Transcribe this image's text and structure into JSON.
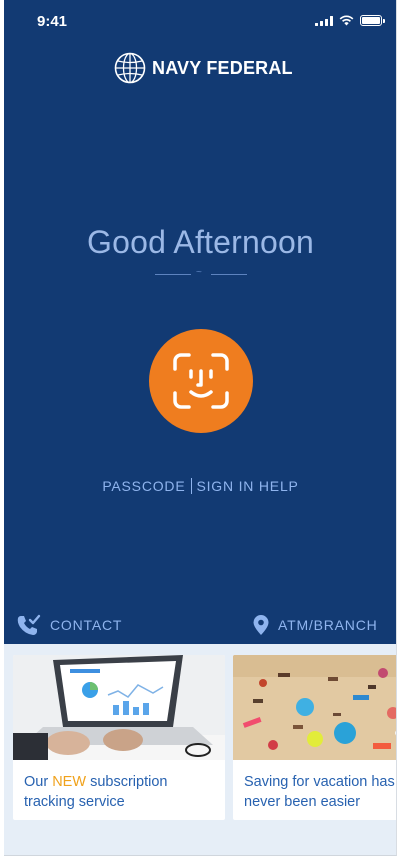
{
  "status_bar": {
    "time": "9:41"
  },
  "brand": {
    "name": "NAVY FEDERAL"
  },
  "greeting": {
    "title": "Good Afternoon"
  },
  "auth": {
    "passcode_label": "PASSCODE",
    "sign_in_help_label": "SIGN IN HELP"
  },
  "actions": {
    "contact_label": "CONTACT",
    "atm_branch_label": "ATM/BRANCH"
  },
  "cards": [
    {
      "caption_prefix": "Our ",
      "caption_highlight": "NEW",
      "caption_suffix": " subscription tracking service"
    },
    {
      "caption": "Saving for vacation has never been easier"
    }
  ],
  "colors": {
    "hero_background": "#123a73",
    "face_id_button": "#ef7d1f",
    "link_text": "#8fb4ee",
    "card_text": "#2862b0",
    "highlight": "#f0a21c",
    "page_background": "#e6eef7"
  }
}
